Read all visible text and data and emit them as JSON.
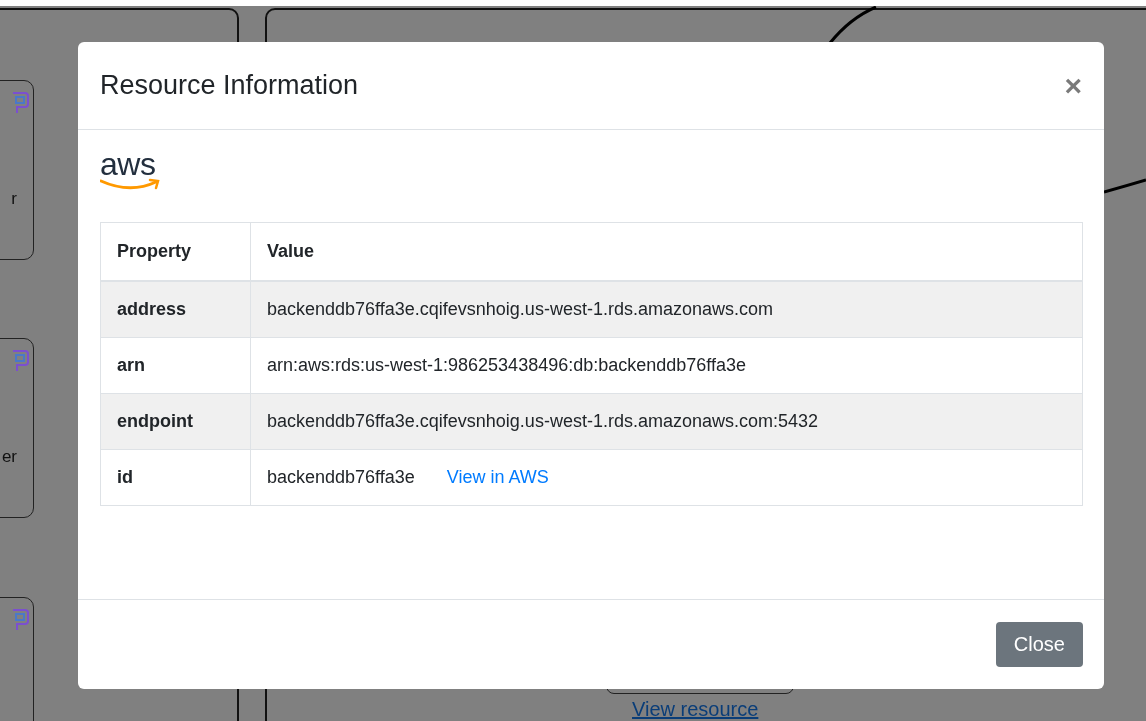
{
  "background": {
    "nodes": [
      {
        "label": "r"
      },
      {
        "label": "er"
      }
    ],
    "link": "View resource"
  },
  "modal": {
    "title": "Resource Information",
    "close": "×",
    "logo": "aws",
    "table": {
      "columns": [
        "Property",
        "Value"
      ],
      "rows": [
        {
          "property": "address",
          "value": "backenddb76ffa3e.cqifevsnhoig.us-west-1.rds.amazonaws.com"
        },
        {
          "property": "arn",
          "value": "arn:aws:rds:us-west-1:986253438496:db:backenddb76ffa3e"
        },
        {
          "property": "endpoint",
          "value": "backenddb76ffa3e.cqifevsnhoig.us-west-1.rds.amazonaws.com:5432"
        },
        {
          "property": "id",
          "value": "backenddb76ffa3e",
          "link": "View in AWS"
        }
      ]
    },
    "footer_button": "Close"
  }
}
